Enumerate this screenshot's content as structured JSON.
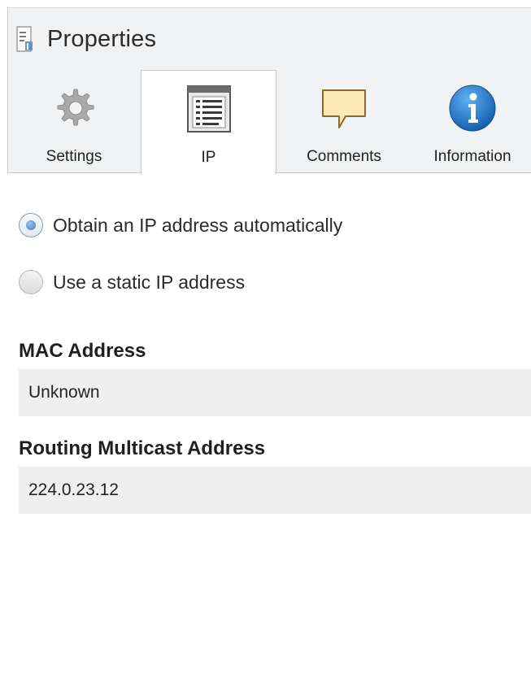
{
  "window": {
    "title": "Properties"
  },
  "tabs": [
    {
      "label": "Settings",
      "icon": "gear-icon",
      "active": false
    },
    {
      "label": "IP",
      "icon": "list-window-icon",
      "active": true
    },
    {
      "label": "Comments",
      "icon": "speech-bubble-icon",
      "active": false
    },
    {
      "label": "Information",
      "icon": "info-icon",
      "active": false
    }
  ],
  "ip": {
    "options": [
      {
        "label": "Obtain an IP address automatically",
        "checked": true
      },
      {
        "label": "Use a static IP address",
        "checked": false
      }
    ],
    "mac": {
      "label": "MAC Address",
      "value": "Unknown"
    },
    "multicast": {
      "label": "Routing Multicast Address",
      "value": "224.0.23.12"
    }
  },
  "colors": {
    "header_bg": "#f1f2f3",
    "field_bg": "#efefef",
    "info_blue": "#1f78c8",
    "bubble_fill": "#fde8b8"
  }
}
